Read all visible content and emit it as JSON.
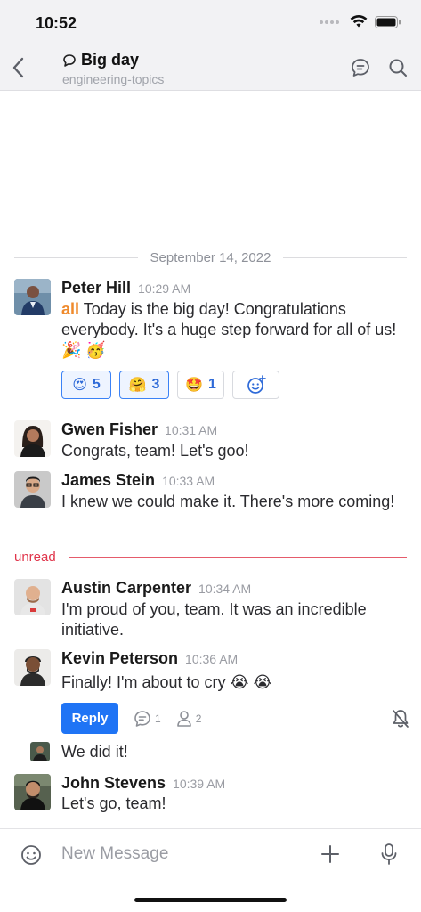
{
  "status": {
    "time": "10:52"
  },
  "header": {
    "title": "Big day",
    "subtitle": "engineering-topics"
  },
  "date_divider": "September 14, 2022",
  "unread_label": "unread",
  "messages": [
    {
      "author": "Peter Hill",
      "time": "10:29 AM",
      "mention": "all",
      "text": " Today is the big day! Congratulations everybody. It's a huge step forward for all of us! 🎉 🥳"
    },
    {
      "author": "Gwen Fisher",
      "time": "10:31 AM",
      "text": "Congrats, team! Let's goo!"
    },
    {
      "author": "James Stein",
      "time": "10:33 AM",
      "text": "I knew we could make it. There's more coming!"
    },
    {
      "author": "Austin Carpenter",
      "time": "10:34 AM",
      "text": "I'm proud of you, team. It was an incredible initiative."
    },
    {
      "author": "Kevin Peterson",
      "time": "10:36 AM",
      "text": "Finally! I'm about to cry 😭 😭"
    },
    {
      "text": "We did it!"
    },
    {
      "author": "John Stevens",
      "time": "10:39 AM",
      "text": "Let's go, team!"
    }
  ],
  "reactions": [
    {
      "emoji": "😍",
      "count": "5"
    },
    {
      "emoji": "🤗",
      "count": "3"
    },
    {
      "emoji": "🤩",
      "count": "1"
    }
  ],
  "thread": {
    "reply_label": "Reply",
    "replies": "1",
    "participants": "2"
  },
  "composer": {
    "placeholder": "New Message"
  },
  "colors": {
    "accent": "#1f74f5",
    "mention": "#ef8a2c",
    "unread": "#e0354b"
  },
  "icons": [
    "back-chevron-icon",
    "thread-bubble-icon",
    "chat-bubble-icon",
    "search-icon",
    "add-reaction-icon",
    "reply-count-icon",
    "participants-icon",
    "bell-off-icon",
    "emoji-icon",
    "plus-icon",
    "mic-icon"
  ]
}
